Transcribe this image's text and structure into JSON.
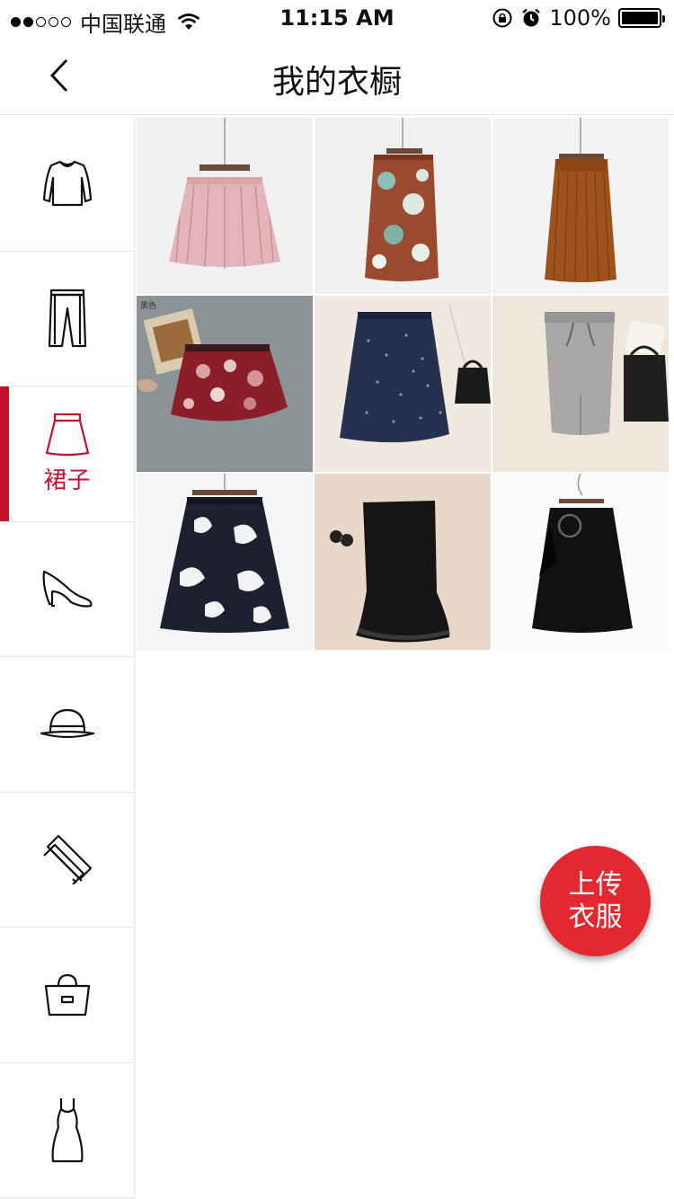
{
  "status": {
    "carrier": "中国联通",
    "time": "11:15 AM",
    "battery": "100%"
  },
  "nav": {
    "title": "我的衣橱",
    "back_icon": "chevron-left-icon"
  },
  "sidebar": {
    "active_index": 2,
    "accent": "#c8102e",
    "items": [
      {
        "icon": "top-shirt-icon",
        "label": ""
      },
      {
        "icon": "pants-icon",
        "label": ""
      },
      {
        "icon": "skirt-icon",
        "label": "裙子"
      },
      {
        "icon": "high-heel-icon",
        "label": ""
      },
      {
        "icon": "hat-icon",
        "label": ""
      },
      {
        "icon": "scarf-icon",
        "label": ""
      },
      {
        "icon": "handbag-icon",
        "label": ""
      },
      {
        "icon": "dress-icon",
        "label": ""
      }
    ]
  },
  "items": [
    {
      "name": "pink-pleated-skirt",
      "bg": "#f1f1f1",
      "color": "#e4b5b8"
    },
    {
      "name": "floral-wrap-skirt",
      "bg": "#f1f1f1",
      "color": "#9b4a2f"
    },
    {
      "name": "brown-pleated-skirt",
      "bg": "#f3f3f3",
      "color": "#a0521d"
    },
    {
      "name": "red-floral-puff-skirt",
      "bg": "#8b9396",
      "color": "#8a1f2a",
      "tag": "黑色"
    },
    {
      "name": "navy-print-midi-skirt",
      "bg": "#efe9df",
      "color": "#26304f"
    },
    {
      "name": "grey-knit-skirt",
      "bg": "#efe7dc",
      "color": "#a8a8a8"
    },
    {
      "name": "black-white-floral-skirt",
      "bg": "#f5f5f5",
      "color": "#1c2030"
    },
    {
      "name": "black-mermaid-skirt",
      "bg": "#e9d7c8",
      "color": "#151515"
    },
    {
      "name": "black-ring-skirt",
      "bg": "#fafafa",
      "color": "#111111"
    }
  ],
  "fab": {
    "line1": "上传",
    "line2": "衣服",
    "color": "#e3282f"
  }
}
